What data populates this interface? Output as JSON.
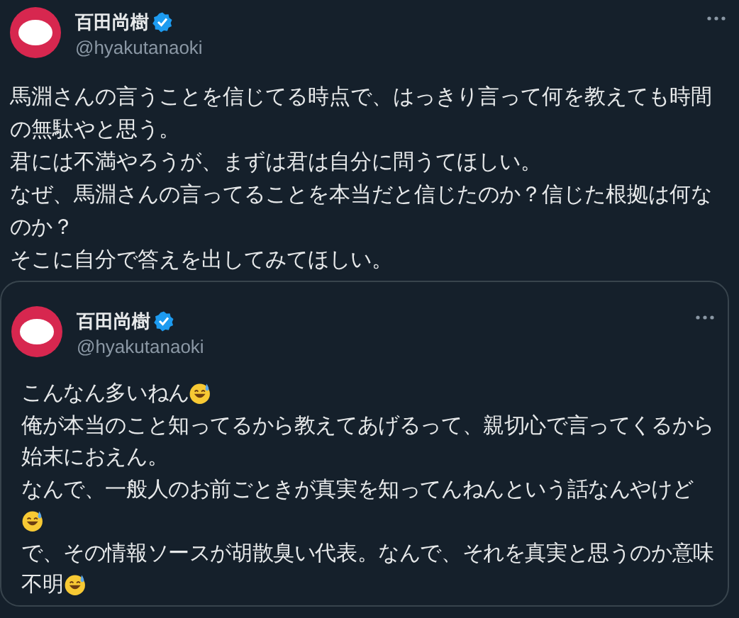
{
  "tweet": {
    "author": {
      "name": "百田尚樹",
      "verified": true,
      "handle": "@hyakutanaoki"
    },
    "lines": [
      {
        "kind": "text",
        "text": "馬淵さんの言うことを信じてる時点で、はっきり言って何を教えても時間",
        "emoji": false
      },
      {
        "kind": "text",
        "text": "の無駄やと思う。",
        "emoji": false
      },
      {
        "kind": "text",
        "text": "君には不満やろうが、まずは君は自分に問うてほしい。",
        "emoji": false
      },
      {
        "kind": "text",
        "text": "なぜ、馬淵さんの言ってることを本当だと信じたのか？信じた根拠は何な",
        "emoji": false
      },
      {
        "kind": "text",
        "text": "のか？",
        "emoji": false
      },
      {
        "kind": "text",
        "text": "そこに自分で答えを出してみてほしい。",
        "emoji": false
      }
    ],
    "quoted": {
      "author": {
        "name": "百田尚樹",
        "verified": true,
        "handle": "@hyakutanaoki"
      },
      "lines": [
        {
          "kind": "text",
          "text": "こんなん多いねん",
          "emoji": true
        },
        {
          "kind": "text",
          "text": "俺が本当のこと知ってるから教えてあげるって、親切心で言ってくるから",
          "emoji": false
        },
        {
          "kind": "text",
          "text": "始末におえん。",
          "emoji": false
        },
        {
          "kind": "text",
          "text": "なんで、一般人のお前ごときが真実を知ってんねんという話なんやけど",
          "emoji": false
        },
        {
          "kind": "emoji"
        },
        {
          "kind": "text",
          "text": "で、その情報ソースが胡散臭い代表。なんで、それを真実と思うのか意味",
          "emoji": false
        },
        {
          "kind": "text",
          "text": "不明",
          "emoji": true
        }
      ]
    }
  }
}
